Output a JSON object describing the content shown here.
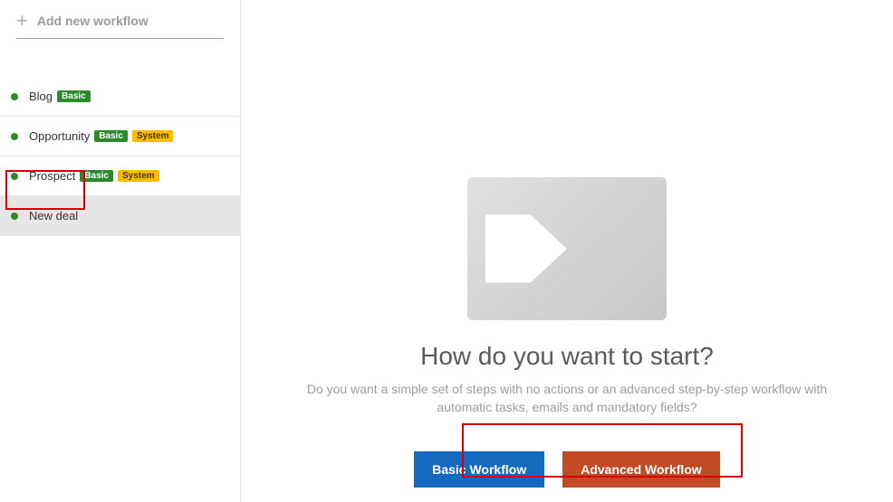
{
  "sidebar": {
    "add_workflow_label": "Add new workflow",
    "items": [
      {
        "name": "Blog",
        "badges": [
          "Basic"
        ]
      },
      {
        "name": "Opportunity",
        "badges": [
          "Basic",
          "System"
        ]
      },
      {
        "name": "Prospect",
        "badges": [
          "Basic",
          "System"
        ]
      },
      {
        "name": "New deal",
        "badges": [],
        "selected": true
      }
    ]
  },
  "badge_labels": {
    "basic": "Basic",
    "system": "System"
  },
  "main": {
    "heading": "How do you want to start?",
    "subheading": "Do you want a simple set of steps with no actions or an advanced step-by-step workflow with automatic tasks, emails and mandatory fields?",
    "basic_btn": "Basic Workflow",
    "advanced_btn": "Advanced Workflow"
  }
}
